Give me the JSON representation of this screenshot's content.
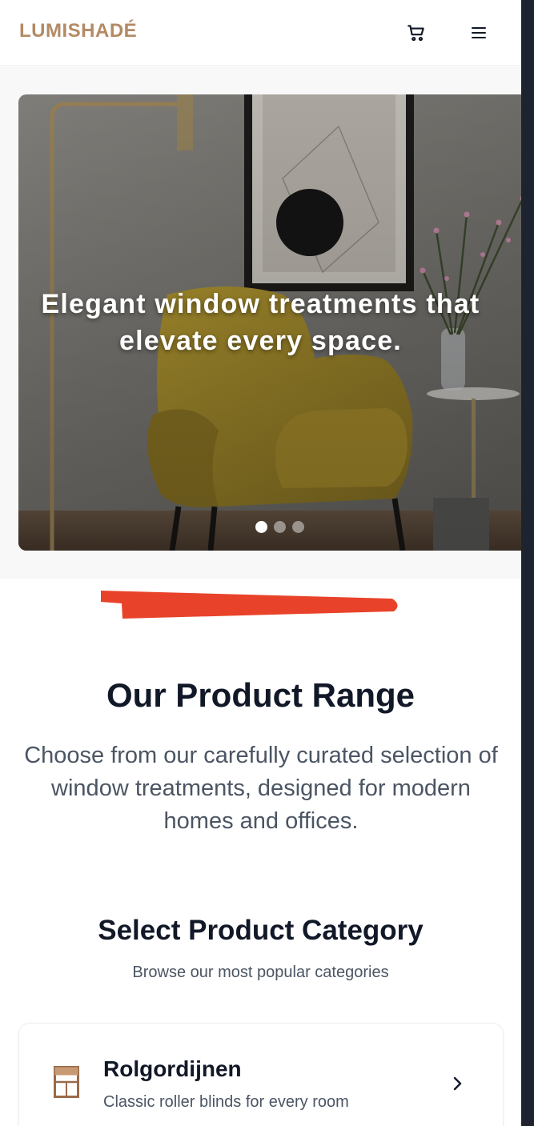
{
  "header": {
    "logo": "LUMISHADÉ",
    "cart_icon": "cart-icon",
    "menu_icon": "hamburger-menu-icon"
  },
  "hero": {
    "title": "Elegant window treatments that elevate every space.",
    "slides_count": 3,
    "active_slide": 1
  },
  "range": {
    "title": "Our Product Range",
    "description": "Choose from our carefully curated selection of window treatments, designed for modern homes and offices."
  },
  "category": {
    "title": "Select Product Category",
    "subtitle": "Browse our most popular categories",
    "items": [
      {
        "title": "Rolgordijnen",
        "description": "Classic roller blinds for every room",
        "icon": "window-blind-icon",
        "chevron": "chevron-right-icon"
      }
    ]
  },
  "colors": {
    "brand": "#b38a64",
    "heading": "#111827",
    "body_text": "#4b5563",
    "annotation_mark": "#e8432a"
  }
}
